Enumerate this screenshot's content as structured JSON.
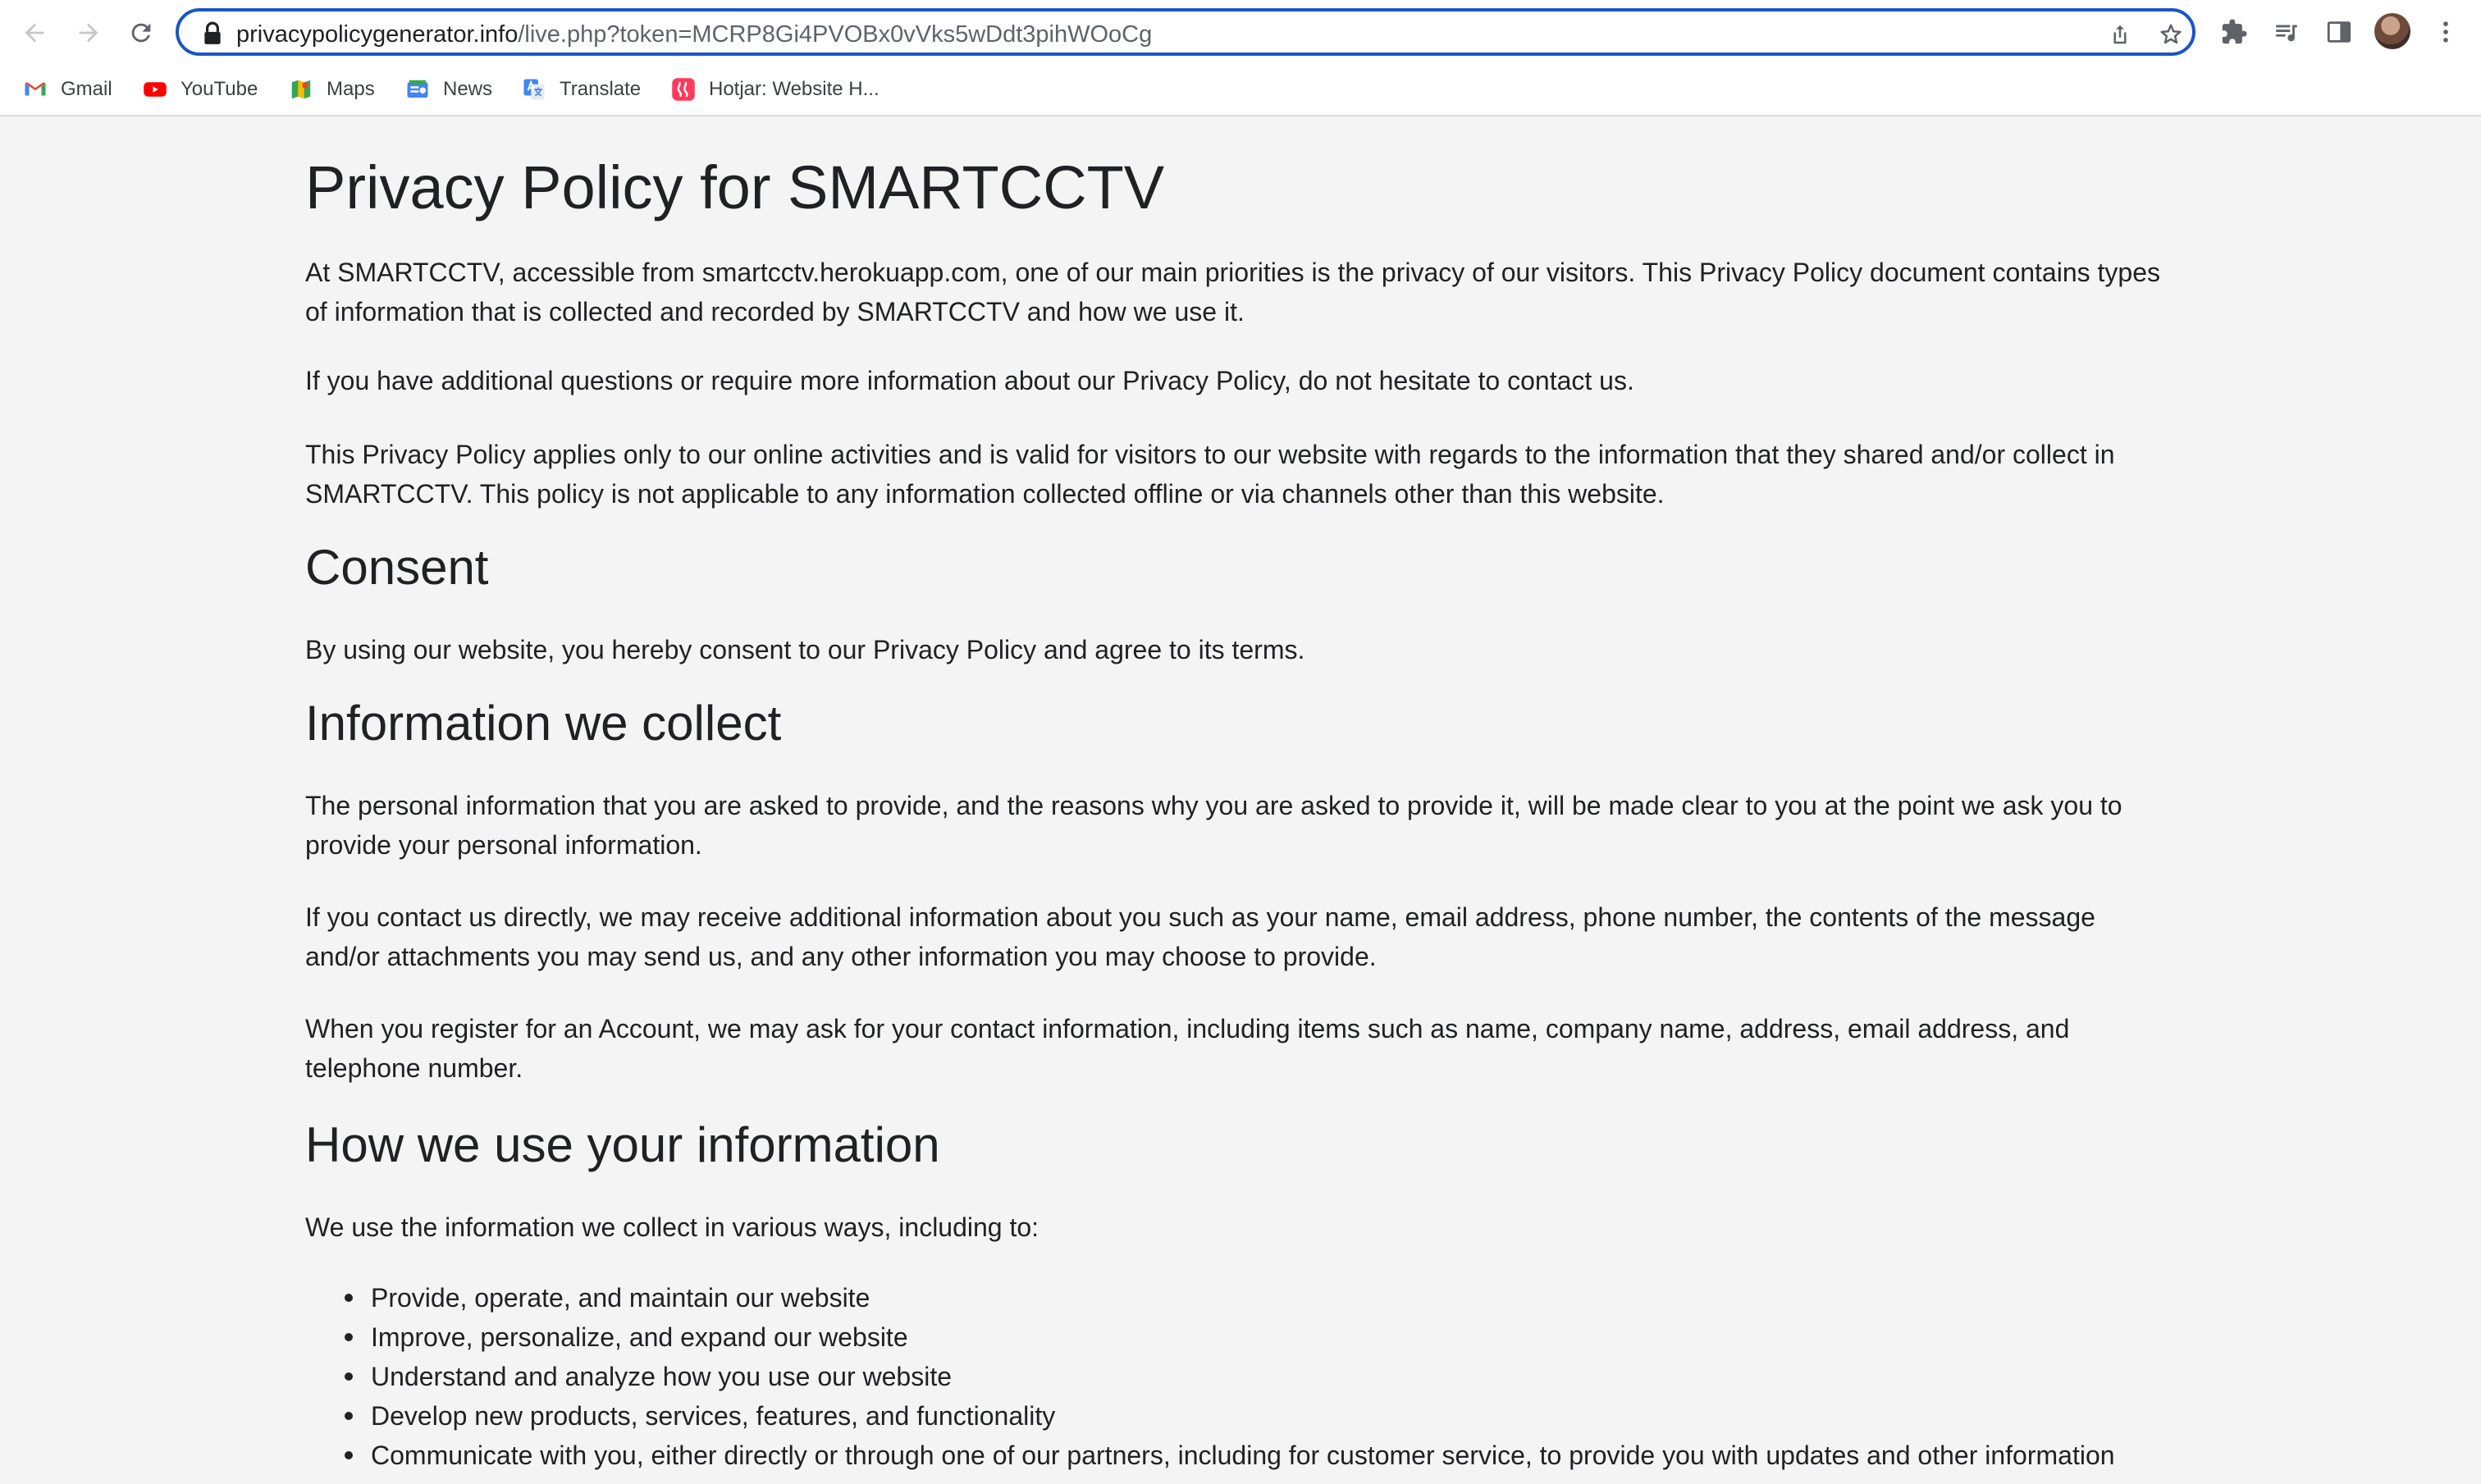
{
  "browser": {
    "url_domain": "privacypolicygenerator.info",
    "url_path": "/live.php?token=MCRP8Gi4PVOBx0vVks5wDdt3pihWOoCg"
  },
  "bookmarks": [
    {
      "label": "Gmail",
      "icon": "gmail-icon"
    },
    {
      "label": "YouTube",
      "icon": "youtube-icon"
    },
    {
      "label": "Maps",
      "icon": "maps-icon"
    },
    {
      "label": "News",
      "icon": "news-icon"
    },
    {
      "label": "Translate",
      "icon": "translate-icon"
    },
    {
      "label": "Hotjar: Website H...",
      "icon": "hotjar-icon"
    }
  ],
  "policy": {
    "title": "Privacy Policy for SMARTCCTV",
    "intro": [
      "At SMARTCCTV, accessible from smartcctv.herokuapp.com, one of our main priorities is the privacy of our visitors. This Privacy Policy document contains types of information that is collected and recorded by SMARTCCTV and how we use it.",
      "If you have additional questions or require more information about our Privacy Policy, do not hesitate to contact us.",
      "This Privacy Policy applies only to our online activities and is valid for visitors to our website with regards to the information that they shared and/or collect in SMARTCCTV. This policy is not applicable to any information collected offline or via channels other than this website."
    ],
    "consent": {
      "heading": "Consent",
      "text": "By using our website, you hereby consent to our Privacy Policy and agree to its terms."
    },
    "collect": {
      "heading": "Information we collect",
      "paragraphs": [
        "The personal information that you are asked to provide, and the reasons why you are asked to provide it, will be made clear to you at the point we ask you to provide your personal information.",
        "If you contact us directly, we may receive additional information about you such as your name, email address, phone number, the contents of the message and/or attachments you may send us, and any other information you may choose to provide.",
        "When you register for an Account, we may ask for your contact information, including items such as name, company name, address, email address, and telephone number."
      ]
    },
    "use": {
      "heading": "How we use your information",
      "intro": "We use the information we collect in various ways, including to:",
      "items": [
        "Provide, operate, and maintain our website",
        "Improve, personalize, and expand our website",
        "Understand and analyze how you use our website",
        "Develop new products, services, features, and functionality",
        "Communicate with you, either directly or through one of our partners, including for customer service, to provide you with updates and other information"
      ]
    }
  },
  "colors": {
    "page_bg": "#f4f4f4",
    "omnibox_focus": "#1a56c4",
    "text": "#202124"
  }
}
